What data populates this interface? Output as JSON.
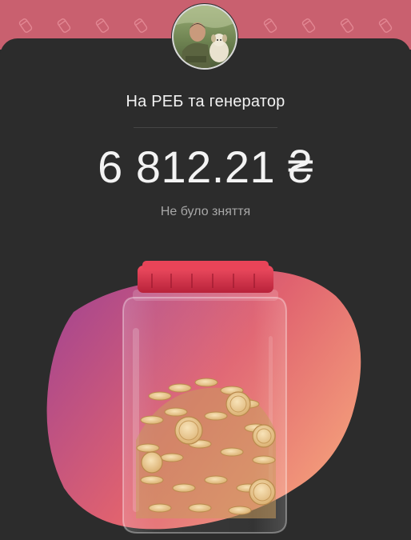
{
  "header": {
    "pattern_icon": "jar-pattern-icon",
    "color": "#c9606f"
  },
  "jar": {
    "owner_avatar": "avatar",
    "title": "На РЕБ та генератор",
    "balance": "6 812.21 ₴",
    "status": "Не було зняття"
  },
  "illustration": {
    "name": "coin-jar-illustration",
    "blob_colors": [
      "#b04a8a",
      "#e0626f",
      "#f5a07c"
    ],
    "lid_color": "#d8324a",
    "coin_color": "#e8c58a"
  }
}
